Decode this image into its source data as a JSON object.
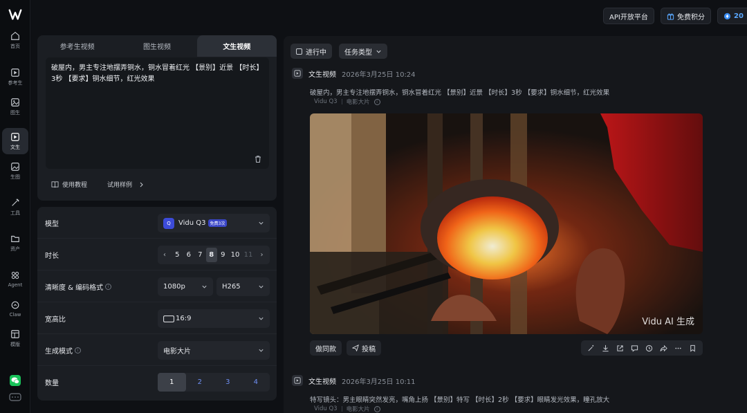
{
  "nav": {
    "items": [
      {
        "label": "首页",
        "icon": "home-icon"
      },
      {
        "label": "参考生",
        "icon": "reference-video-icon"
      },
      {
        "label": "图生",
        "icon": "image-video-icon"
      },
      {
        "label": "文生",
        "icon": "text-video-icon"
      },
      {
        "label": "生图",
        "icon": "image-gen-icon"
      },
      {
        "label": "工具",
        "icon": "tools-icon"
      },
      {
        "label": "资产",
        "icon": "folder-icon"
      },
      {
        "label": "Agent",
        "icon": "agent-icon"
      },
      {
        "label": "Claw",
        "icon": "claw-icon"
      },
      {
        "label": "模版",
        "icon": "template-icon"
      }
    ],
    "active": "文生"
  },
  "topbar": {
    "api_label": "API开放平台",
    "free_credits_label": "免费积分",
    "credits_value": "20"
  },
  "create": {
    "tabs": [
      "参考生视频",
      "图生视频",
      "文生视频"
    ],
    "active_tab": "文生视频",
    "prompt": "破屋内，男主专注地摆弄铜水，铜水冒着红光 【景别】近景 【时长】3秒 【要求】铜水细节，红光效果",
    "tutorial_label": "使用教程",
    "example_label": "试用样例"
  },
  "settings": {
    "model_label": "模型",
    "model_value": "Vidu Q3",
    "model_badge": "免费3次",
    "duration_label": "时长",
    "duration_options": [
      "5",
      "6",
      "7",
      "8",
      "9",
      "10",
      "11"
    ],
    "duration_selected": "8",
    "quality_label": "清晰度 & 编码格式",
    "resolution_value": "1080p",
    "codec_value": "H265",
    "aspect_label": "宽高比",
    "aspect_value": "16:9",
    "mode_label": "生成模式",
    "mode_value": "电影大片",
    "count_label": "数量",
    "count_options": [
      "1",
      "2",
      "3",
      "4"
    ],
    "count_selected": "1"
  },
  "feed": {
    "filter_status": "进行中",
    "filter_type": "任务类型",
    "tasks": [
      {
        "type": "文生视频",
        "time": "2026年3月25日 10:24",
        "prompt": "破屋内，男主专注地摆弄铜水，铜水冒着红光 【景别】近景 【时长】3秒 【要求】铜水细节，红光效果",
        "model": "Vidu Q3",
        "mode": "电影大片",
        "watermark": "Vidu AI 生成",
        "same_label": "做同款",
        "submit_label": "投稿"
      },
      {
        "type": "文生视频",
        "time": "2026年3月25日 10:11",
        "prompt": "特写镜头：男主眼睛突然发亮，嘴角上扬 【景别】特写 【时长】2秒 【要求】眼睛发光效果，瞳孔放大",
        "model": "Vidu Q3",
        "mode": "电影大片"
      }
    ]
  },
  "colors": {
    "accent": "#3c4bd9",
    "count_text": "#6f8ff3"
  }
}
